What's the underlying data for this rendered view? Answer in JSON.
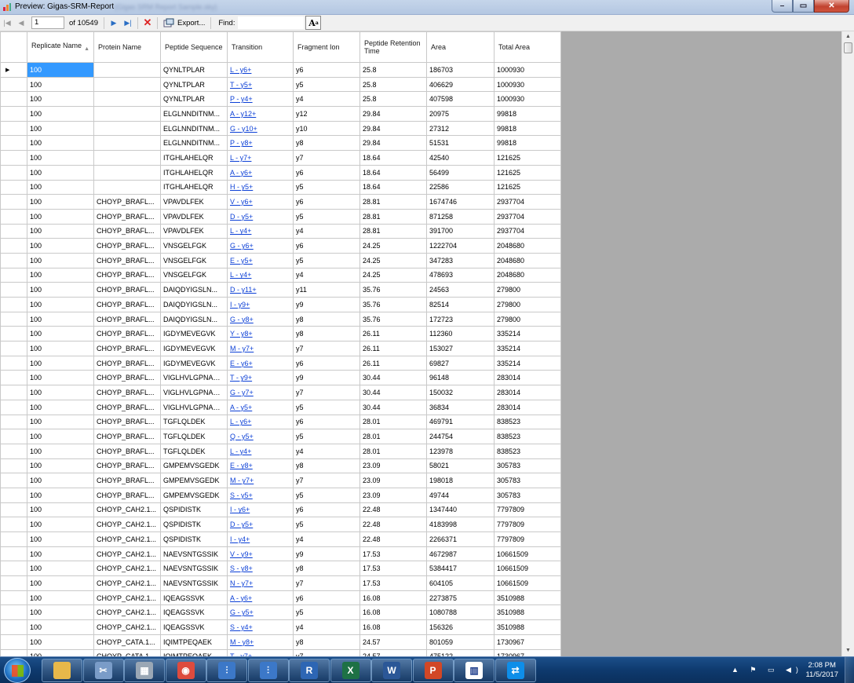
{
  "window": {
    "title": "Preview: Gigas-SRM-Report",
    "title_blurred": "(Gigas SRM Report Sample.sky)",
    "min_label": "–",
    "max_label": "▭",
    "close_label": "✕"
  },
  "toolbar": {
    "page_value": "1",
    "of_label": "of 10549",
    "export_label": "Export...",
    "find_label": "Find:",
    "find_value": "",
    "font_label": "A"
  },
  "columns": [
    "Replicate Name",
    "Protein Name",
    "Peptide Sequence",
    "Transition",
    "Fragment Ion",
    "Peptide Retention Time",
    "Area",
    "Total Area"
  ],
  "rows": [
    [
      "100",
      "",
      "QYNLTPLAR",
      "L - y6+",
      "y6",
      "25.8",
      "186703",
      "1000930"
    ],
    [
      "100",
      "",
      "QYNLTPLAR",
      "T - y5+",
      "y5",
      "25.8",
      "406629",
      "1000930"
    ],
    [
      "100",
      "",
      "QYNLTPLAR",
      "P - y4+",
      "y4",
      "25.8",
      "407598",
      "1000930"
    ],
    [
      "100",
      "",
      "ELGLNNDITNM...",
      "A - y12+",
      "y12",
      "29.84",
      "20975",
      "99818"
    ],
    [
      "100",
      "",
      "ELGLNNDITNM...",
      "G - y10+",
      "y10",
      "29.84",
      "27312",
      "99818"
    ],
    [
      "100",
      "",
      "ELGLNNDITNM...",
      "P - y8+",
      "y8",
      "29.84",
      "51531",
      "99818"
    ],
    [
      "100",
      "",
      "ITGHLAHELQR",
      "L - y7+",
      "y7",
      "18.64",
      "42540",
      "121625"
    ],
    [
      "100",
      "",
      "ITGHLAHELQR",
      "A - y6+",
      "y6",
      "18.64",
      "56499",
      "121625"
    ],
    [
      "100",
      "",
      "ITGHLAHELQR",
      "H - y5+",
      "y5",
      "18.64",
      "22586",
      "121625"
    ],
    [
      "100",
      "CHOYP_BRAFL...",
      "VPAVDLFEK",
      "V - y6+",
      "y6",
      "28.81",
      "1674746",
      "2937704"
    ],
    [
      "100",
      "CHOYP_BRAFL...",
      "VPAVDLFEK",
      "D - y5+",
      "y5",
      "28.81",
      "871258",
      "2937704"
    ],
    [
      "100",
      "CHOYP_BRAFL...",
      "VPAVDLFEK",
      "L - y4+",
      "y4",
      "28.81",
      "391700",
      "2937704"
    ],
    [
      "100",
      "CHOYP_BRAFL...",
      "VNSGELFGK",
      "G - y6+",
      "y6",
      "24.25",
      "1222704",
      "2048680"
    ],
    [
      "100",
      "CHOYP_BRAFL...",
      "VNSGELFGK",
      "E - y5+",
      "y5",
      "24.25",
      "347283",
      "2048680"
    ],
    [
      "100",
      "CHOYP_BRAFL...",
      "VNSGELFGK",
      "L - y4+",
      "y4",
      "24.25",
      "478693",
      "2048680"
    ],
    [
      "100",
      "CHOYP_BRAFL...",
      "DAIQDYIGSLN...",
      "D - y11+",
      "y11",
      "35.76",
      "24563",
      "279800"
    ],
    [
      "100",
      "CHOYP_BRAFL...",
      "DAIQDYIGSLN...",
      "I - y9+",
      "y9",
      "35.76",
      "82514",
      "279800"
    ],
    [
      "100",
      "CHOYP_BRAFL...",
      "DAIQDYIGSLN...",
      "G - y8+",
      "y8",
      "35.76",
      "172723",
      "279800"
    ],
    [
      "100",
      "CHOYP_BRAFL...",
      "IGDYMEVEGVK",
      "Y - y8+",
      "y8",
      "26.11",
      "112360",
      "335214"
    ],
    [
      "100",
      "CHOYP_BRAFL...",
      "IGDYMEVEGVK",
      "M - y7+",
      "y7",
      "26.11",
      "153027",
      "335214"
    ],
    [
      "100",
      "CHOYP_BRAFL...",
      "IGDYMEVEGVK",
      "E - y6+",
      "y6",
      "26.11",
      "69827",
      "335214"
    ],
    [
      "100",
      "CHOYP_BRAFL...",
      "VIGLHVLGPNAG...",
      "T - y9+",
      "y9",
      "30.44",
      "96148",
      "283014"
    ],
    [
      "100",
      "CHOYP_BRAFL...",
      "VIGLHVLGPNAG...",
      "G - y7+",
      "y7",
      "30.44",
      "150032",
      "283014"
    ],
    [
      "100",
      "CHOYP_BRAFL...",
      "VIGLHVLGPNAG...",
      "A - y5+",
      "y5",
      "30.44",
      "36834",
      "283014"
    ],
    [
      "100",
      "CHOYP_BRAFL...",
      "TGFLQLDEK",
      "L - y6+",
      "y6",
      "28.01",
      "469791",
      "838523"
    ],
    [
      "100",
      "CHOYP_BRAFL...",
      "TGFLQLDEK",
      "Q - y5+",
      "y5",
      "28.01",
      "244754",
      "838523"
    ],
    [
      "100",
      "CHOYP_BRAFL...",
      "TGFLQLDEK",
      "L - y4+",
      "y4",
      "28.01",
      "123978",
      "838523"
    ],
    [
      "100",
      "CHOYP_BRAFL...",
      "GMPEMVSGEDK",
      "E - y8+",
      "y8",
      "23.09",
      "58021",
      "305783"
    ],
    [
      "100",
      "CHOYP_BRAFL...",
      "GMPEMVSGEDK",
      "M - y7+",
      "y7",
      "23.09",
      "198018",
      "305783"
    ],
    [
      "100",
      "CHOYP_BRAFL...",
      "GMPEMVSGEDK",
      "S - y5+",
      "y5",
      "23.09",
      "49744",
      "305783"
    ],
    [
      "100",
      "CHOYP_CAH2.1...",
      "QSPIDISTK",
      "I - y6+",
      "y6",
      "22.48",
      "1347440",
      "7797809"
    ],
    [
      "100",
      "CHOYP_CAH2.1...",
      "QSPIDISTK",
      "D - y5+",
      "y5",
      "22.48",
      "4183998",
      "7797809"
    ],
    [
      "100",
      "CHOYP_CAH2.1...",
      "QSPIDISTK",
      "I - y4+",
      "y4",
      "22.48",
      "2266371",
      "7797809"
    ],
    [
      "100",
      "CHOYP_CAH2.1...",
      "NAEVSNTGSSIK",
      "V - y9+",
      "y9",
      "17.53",
      "4672987",
      "10661509"
    ],
    [
      "100",
      "CHOYP_CAH2.1...",
      "NAEVSNTGSSIK",
      "S - y8+",
      "y8",
      "17.53",
      "5384417",
      "10661509"
    ],
    [
      "100",
      "CHOYP_CAH2.1...",
      "NAEVSNTGSSIK",
      "N - y7+",
      "y7",
      "17.53",
      "604105",
      "10661509"
    ],
    [
      "100",
      "CHOYP_CAH2.1...",
      "IQEAGSSVK",
      "A - y6+",
      "y6",
      "16.08",
      "2273875",
      "3510988"
    ],
    [
      "100",
      "CHOYP_CAH2.1...",
      "IQEAGSSVK",
      "G - y5+",
      "y5",
      "16.08",
      "1080788",
      "3510988"
    ],
    [
      "100",
      "CHOYP_CAH2.1...",
      "IQEAGSSVK",
      "S - y4+",
      "y4",
      "16.08",
      "156326",
      "3510988"
    ],
    [
      "100",
      "CHOYP_CATA.1...",
      "IQIMTPEQAEK",
      "M - y8+",
      "y8",
      "24.57",
      "801059",
      "1730967"
    ],
    [
      "100",
      "CHOYP_CATA.1...",
      "IQIMTPEQAEK",
      "T - y7+",
      "y7",
      "24.57",
      "475122",
      "1730967"
    ]
  ],
  "taskbar": {
    "apps": [
      {
        "name": "file-explorer",
        "color": "#e8b84a",
        "glyph": ""
      },
      {
        "name": "snipping-tool",
        "color": "#7a9cc8",
        "glyph": "✂"
      },
      {
        "name": "calculator",
        "color": "#9aa7b5",
        "glyph": "▦"
      },
      {
        "name": "chrome",
        "color": "#dd4b3e",
        "glyph": "◉"
      },
      {
        "name": "skyline",
        "color": "#3c78c8",
        "glyph": "⫶"
      },
      {
        "name": "skyline-daily",
        "color": "#3c78c8",
        "glyph": "⫶"
      },
      {
        "name": "r-console",
        "color": "#2d66b4",
        "glyph": "R"
      },
      {
        "name": "excel",
        "color": "#1e7145",
        "glyph": "X"
      },
      {
        "name": "word",
        "color": "#2b5797",
        "glyph": "W"
      },
      {
        "name": "powerpoint",
        "color": "#d24726",
        "glyph": "P"
      },
      {
        "name": "chart-app",
        "color": "#ffffff",
        "glyph": "▥"
      },
      {
        "name": "teamviewer",
        "color": "#0e8ee9",
        "glyph": "⇄"
      }
    ],
    "time": "2:08 PM",
    "date": "11/5/2017"
  }
}
